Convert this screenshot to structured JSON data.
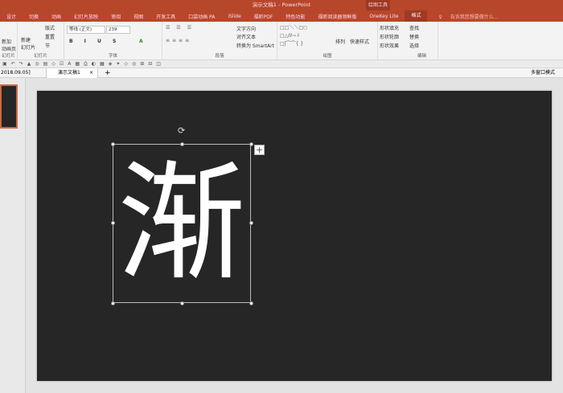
{
  "title": "演示文稿1 - PowerPoint",
  "context_title": "绘图工具",
  "tabs": [
    "设计",
    "切换",
    "动画",
    "幻灯片放映",
    "审阅",
    "视图",
    "开发工具",
    "口袋动画 PA",
    "iSlide",
    "福昕PDF",
    "特色功能",
    "福昕阅读器领鲜版",
    "OneKey Lite",
    "格式"
  ],
  "tell_me": "告诉我您想要做什么...",
  "ribbon": {
    "new_slide": "新加\n动画页",
    "new_slide2": "新建\n幻灯片",
    "layout": "版式",
    "reset": "重置",
    "section": "节",
    "font_name": "等线 (正文)",
    "font_size": "239",
    "text_direction": "文字方向",
    "align_text": "对齐文本",
    "smartart": "转换为 SmartArt",
    "arrange": "排列",
    "quick_styles": "快速样式",
    "shape_fill": "形状填充",
    "shape_outline": "形状轮廓",
    "shape_effects": "形状效果",
    "find": "查找",
    "replace": "替换",
    "select": "选择",
    "groups": {
      "slides0": "幻灯片",
      "slides": "幻灯片",
      "font": "字体",
      "paragraph": "段落",
      "drawing": "绘图",
      "editing": "编辑"
    }
  },
  "doc": {
    "prev_tab": "2018.09.05]",
    "tab": "演示文稿1",
    "close": "×",
    "new_tab": "+",
    "multi_window": "多窗口模式"
  },
  "slide": {
    "text": "渐"
  },
  "colors": {
    "accent": "#b7472a",
    "slide_bg": "#262626"
  }
}
